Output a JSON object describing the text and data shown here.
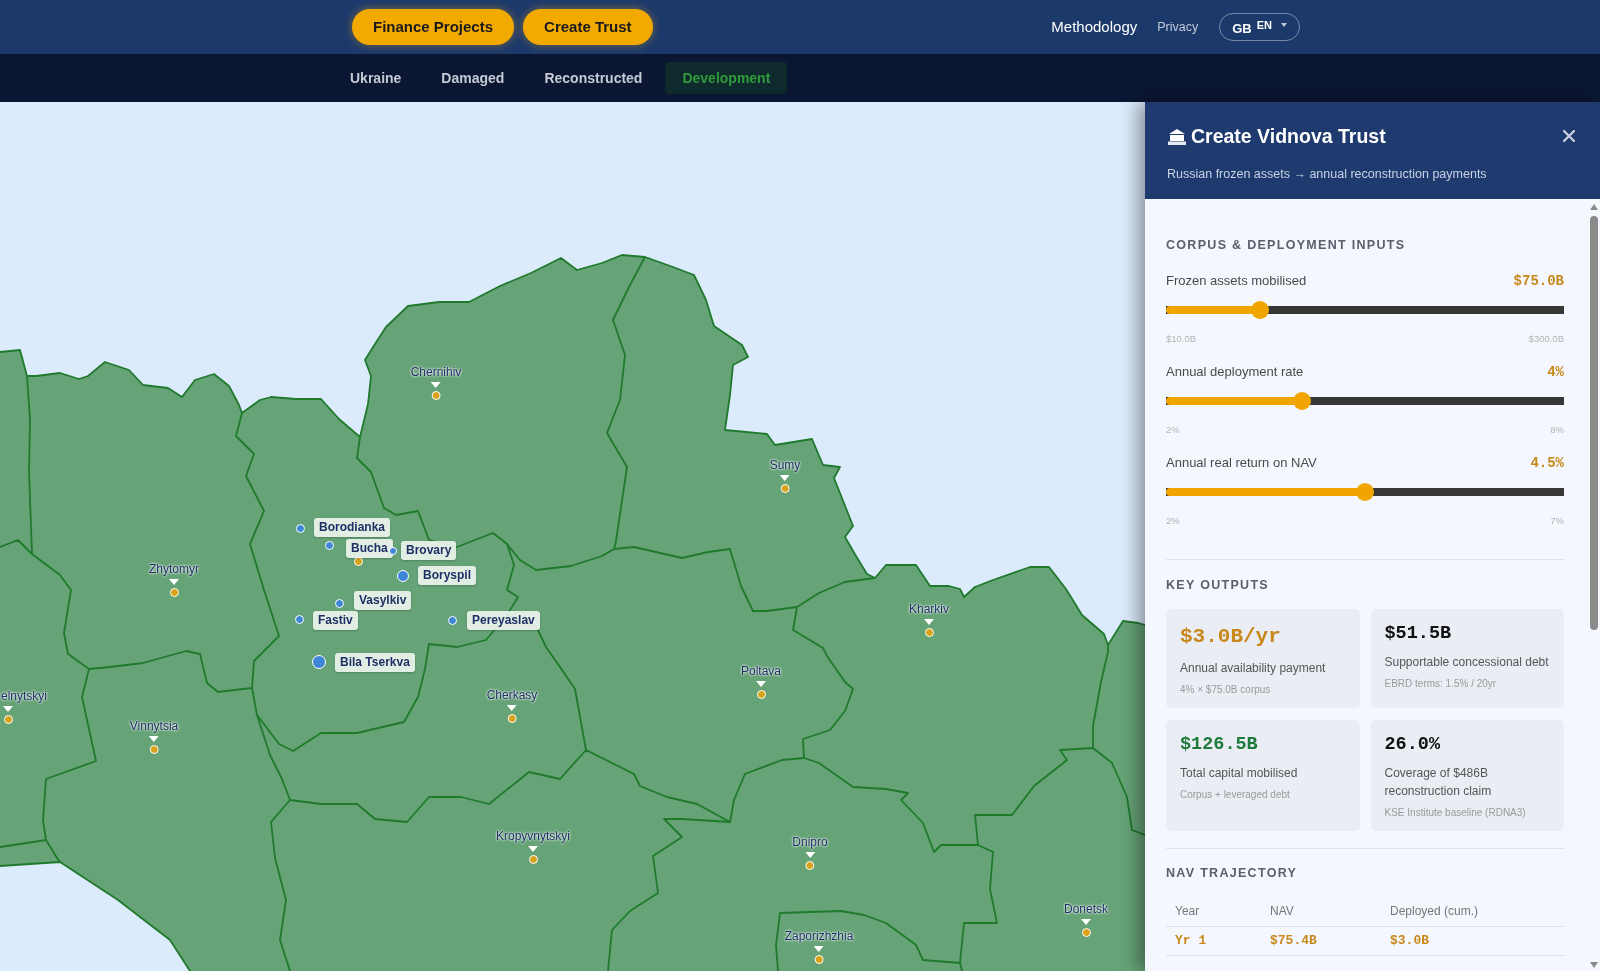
{
  "top_bar": {
    "actions": [
      {
        "label": "Finance Projects"
      },
      {
        "label": "Create Trust"
      }
    ],
    "links": [
      {
        "label": "Methodology",
        "kind": "main"
      },
      {
        "label": "Privacy",
        "kind": "minor"
      }
    ],
    "language": {
      "flag": "GB",
      "code": "EN"
    }
  },
  "tabs": [
    {
      "label": "Ukraine",
      "selected": false
    },
    {
      "label": "Damaged",
      "selected": false
    },
    {
      "label": "Reconstructed",
      "selected": false
    },
    {
      "label": "Development",
      "selected": true
    }
  ],
  "map": {
    "oblast_centres": [
      {
        "name": "Chernihiv"
      },
      {
        "name": "Sumy"
      },
      {
        "name": "Zhytomyr"
      },
      {
        "name": "Kharkiv"
      },
      {
        "name": "Poltava"
      },
      {
        "name": "elnytskyi"
      },
      {
        "name": "Cherkasy"
      },
      {
        "name": "Vinnytsia"
      },
      {
        "name": "Kropyvnytskyi"
      },
      {
        "name": "Dnipro"
      },
      {
        "name": "Donetsk"
      },
      {
        "name": "Zaporizhzhia"
      }
    ],
    "settlements": [
      {
        "name": "Borodianka"
      },
      {
        "name": "Bucha"
      },
      {
        "name": "Brovary"
      },
      {
        "name": "Boryspil"
      },
      {
        "name": "Vasylkiv"
      },
      {
        "name": "Fastiv"
      },
      {
        "name": "Pereyaslav"
      },
      {
        "name": "Bila Tserkva"
      }
    ]
  },
  "panel": {
    "title": "Create Vidnova Trust",
    "subtitle": "Russian frozen assets → annual reconstruction payments",
    "inputs_heading": "CORPUS & DEPLOYMENT INPUTS",
    "inputs": [
      {
        "label": "Frozen assets mobilised",
        "value": "$75.0B",
        "level": 0.224,
        "min": "$10.0B",
        "max": "$300.0B"
      },
      {
        "label": "Annual deployment rate",
        "value": "4%",
        "level": 0.333,
        "min": "2%",
        "max": "8%"
      },
      {
        "label": "Annual real return on NAV",
        "value": "4.5%",
        "level": 0.5,
        "min": "2%",
        "max": "7%"
      }
    ],
    "outputs_heading": "KEY OUTPUTS",
    "outputs": [
      {
        "kind": "headline",
        "value": "$3.0B/yr",
        "color": "#c8881a",
        "label": "Annual availability payment",
        "note": "4% × $75.0B corpus"
      },
      {
        "kind": "figure",
        "value": "$51.5B",
        "color": "#111111",
        "label": "Supportable concessional debt",
        "note": "EBRD terms: 1.5% / 20yr"
      },
      {
        "kind": "figure",
        "value": "$126.5B",
        "color": "#1e7b3c",
        "label": "Total capital mobilised",
        "note": "Corpus + leveraged debt"
      },
      {
        "kind": "figure",
        "value": "26.0%",
        "color": "#111111",
        "label": "Coverage of $486B reconstruction claim",
        "note": "KSE Institute baseline (RDNA3)"
      }
    ],
    "trajectory_heading": "NAV TRAJECTORY",
    "table": {
      "columns": [
        "Year",
        "NAV",
        "Deployed (cum.)"
      ],
      "rows": [
        {
          "highlighted": true,
          "cells": [
            "Yr 1",
            "$75.4B",
            "$3.0B"
          ]
        }
      ]
    }
  }
}
